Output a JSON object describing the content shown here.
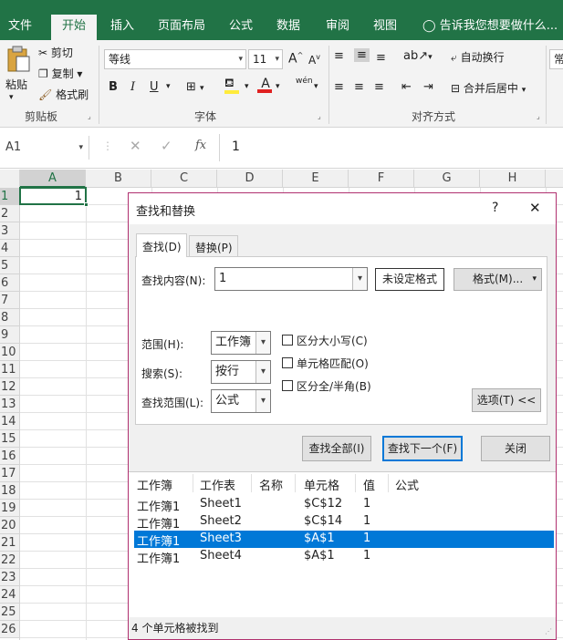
{
  "ribbon_tabs": [
    "文件",
    "开始",
    "插入",
    "页面布局",
    "公式",
    "数据",
    "审阅",
    "视图"
  ],
  "active_tab": "开始",
  "tell_me": "告诉我您想要做什么...",
  "clipboard": {
    "paste": "粘贴",
    "cut": "剪切",
    "copy": "复制",
    "format_painter": "格式刷",
    "group_label": "剪贴板"
  },
  "font": {
    "name": "等线",
    "size": "11",
    "group_label": "字体",
    "bold": "B",
    "italic": "I",
    "underline": "U",
    "phonetic": "wén"
  },
  "alignment": {
    "wrap_text": "自动换行",
    "merge_center": "合并后居中",
    "group_label": "对齐方式",
    "number_format_partial": "常"
  },
  "formula_bar": {
    "name_box": "A1",
    "formula": "1"
  },
  "columns": [
    "A",
    "B",
    "C",
    "D",
    "E",
    "F",
    "G",
    "H"
  ],
  "rows": [
    "1",
    "2",
    "3",
    "4",
    "5",
    "6",
    "7",
    "8",
    "9",
    "10",
    "11",
    "12",
    "13",
    "14",
    "15",
    "16",
    "17",
    "18",
    "19",
    "20",
    "21",
    "22",
    "23",
    "24",
    "25",
    "26"
  ],
  "cell_a1": "1",
  "dialog": {
    "title": "查找和替换",
    "help": "?",
    "close": "✕",
    "tab_find": "查找(D)",
    "tab_replace": "替换(P)",
    "find_what_label": "查找内容(N):",
    "find_what_value": "1",
    "format_preview": "未设定格式",
    "format_button": "格式(M)...",
    "within_label": "范围(H):",
    "within_value": "工作簿",
    "search_label": "搜索(S):",
    "search_value": "按行",
    "look_in_label": "查找范围(L):",
    "look_in_value": "公式",
    "match_case": "区分大小写(C)",
    "match_entire": "单元格匹配(O)",
    "match_byte": "区分全/半角(B)",
    "options_button": "选项(T) <<",
    "find_all": "查找全部(I)",
    "find_next": "查找下一个(F)",
    "close_button": "关闭",
    "results_headers": [
      "工作簿",
      "工作表",
      "名称",
      "单元格",
      "值",
      "公式"
    ],
    "results": [
      {
        "book": "工作簿1",
        "sheet": "Sheet1",
        "name": "",
        "cell": "$C$12",
        "value": "1",
        "formula": ""
      },
      {
        "book": "工作簿1",
        "sheet": "Sheet2",
        "name": "",
        "cell": "$C$14",
        "value": "1",
        "formula": ""
      },
      {
        "book": "工作簿1",
        "sheet": "Sheet3",
        "name": "",
        "cell": "$A$1",
        "value": "1",
        "formula": ""
      },
      {
        "book": "工作簿1",
        "sheet": "Sheet4",
        "name": "",
        "cell": "$A$1",
        "value": "1",
        "formula": ""
      }
    ],
    "selected_result_index": 2,
    "status": "4 个单元格被找到"
  },
  "colors": {
    "excel_green": "#217346",
    "selection_blue": "#0078d7",
    "dialog_border": "#b0306f",
    "font_color_red": "#e02020",
    "highlight_yellow": "#ffeb3b"
  }
}
